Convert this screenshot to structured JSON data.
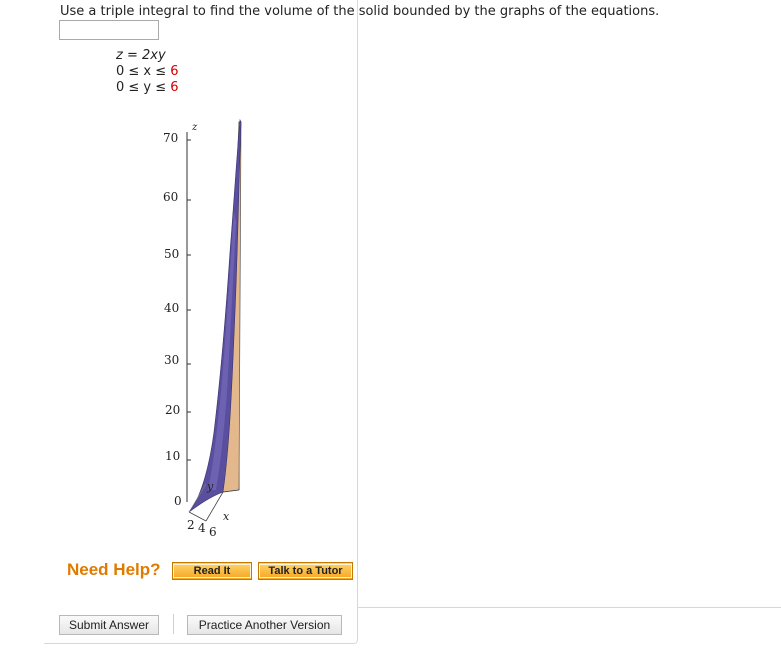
{
  "question": {
    "text": "Use a triple integral to find the volume of the solid bounded by the graphs of the equations."
  },
  "equations": {
    "line1": "z = 2xy",
    "line2_prefix": "0 ≤ x ≤ ",
    "line2_value": "6",
    "line3_prefix": "0 ≤ y ≤ ",
    "line3_value": "6"
  },
  "plot": {
    "z_axis_label": "z",
    "z_ticks": [
      "70",
      "60",
      "50",
      "40",
      "30",
      "20",
      "10",
      "0"
    ],
    "y_axis_label": "y",
    "x_axis_label": "x",
    "bottom_ticks": [
      "2",
      "4",
      "6"
    ],
    "colors": {
      "surface": "#5a4f9e",
      "side": "#e3b88c"
    }
  },
  "help": {
    "label": "Need Help?",
    "read_it": "Read It",
    "talk_to_tutor": "Talk to a Tutor"
  },
  "actions": {
    "submit": "Submit Answer",
    "practice": "Practice Another Version"
  }
}
